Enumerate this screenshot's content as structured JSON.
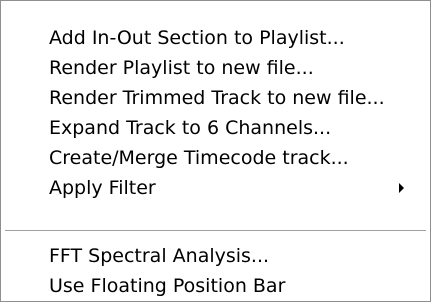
{
  "menu": {
    "items": [
      {
        "label": "Add In-Out Section to Playlist..."
      },
      {
        "label": "Render Playlist to new file..."
      },
      {
        "label": "Render Trimmed Track to new file..."
      },
      {
        "label": "Expand Track to 6 Channels..."
      },
      {
        "label": "Create/Merge Timecode track..."
      },
      {
        "label": "Apply Filter",
        "submenu": true,
        "icon": "submenu-arrow-icon"
      },
      {
        "label": "FFT Spectral Analysis..."
      },
      {
        "label": "Use Floating Position Bar"
      }
    ]
  }
}
